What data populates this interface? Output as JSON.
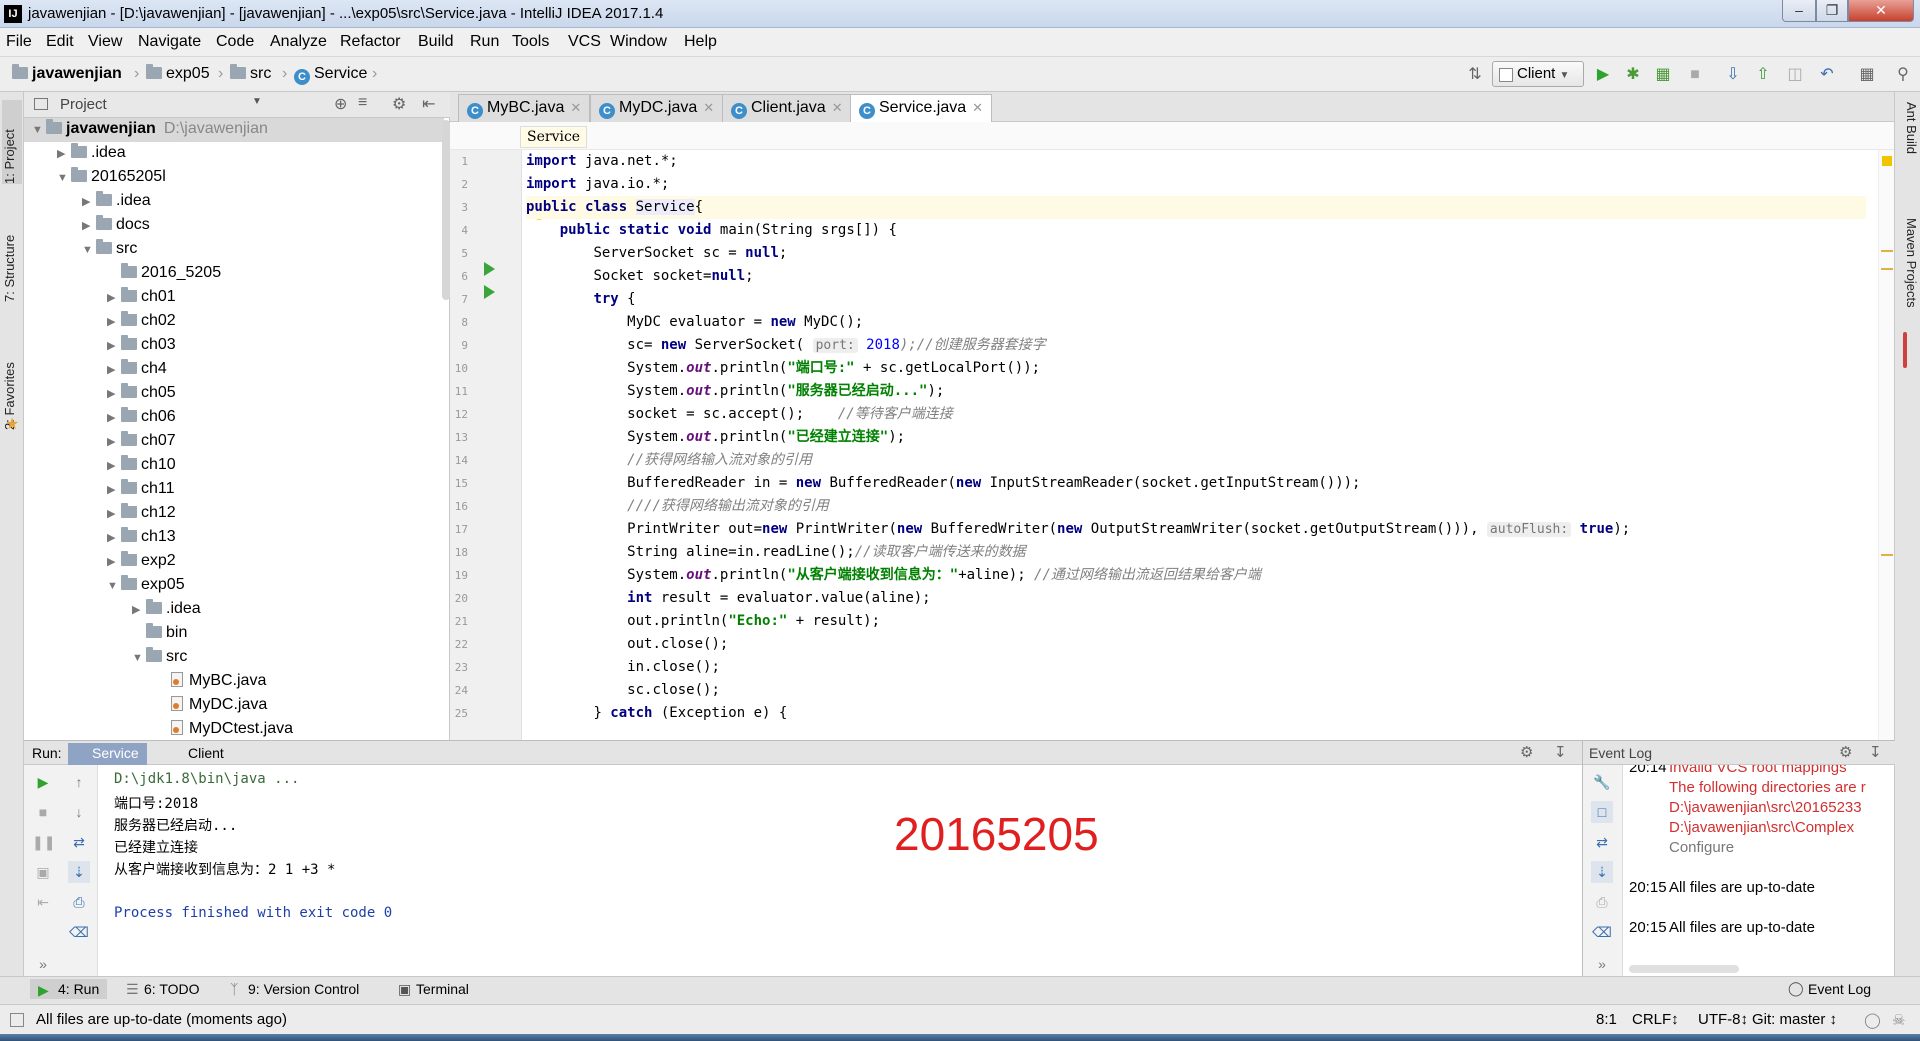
{
  "window": {
    "title": "javawenjian - [D:\\javawenjian] - [javawenjian] - ...\\exp05\\src\\Service.java - IntelliJ IDEA 2017.1.4",
    "icon_letter": "IJ"
  },
  "menu": [
    "File",
    "Edit",
    "View",
    "Navigate",
    "Code",
    "Analyze",
    "Refactor",
    "Build",
    "Run",
    "Tools",
    "VCS",
    "Window",
    "Help"
  ],
  "breadcrumb": [
    "javawenjian",
    "exp05",
    "src",
    "Service"
  ],
  "run_config": "Client",
  "project_panel": {
    "title": "Project",
    "tree": [
      {
        "label": "javawenjian",
        "path": "D:\\javawenjian",
        "depth": 0,
        "type": "module",
        "expanded": true
      },
      {
        "label": ".idea",
        "depth": 1,
        "type": "folder",
        "expanded": false
      },
      {
        "label": "20165205l",
        "depth": 1,
        "type": "folder",
        "expanded": true
      },
      {
        "label": ".idea",
        "depth": 2,
        "type": "folder",
        "expanded": false
      },
      {
        "label": "docs",
        "depth": 2,
        "type": "folder",
        "expanded": false
      },
      {
        "label": "src",
        "depth": 2,
        "type": "folder",
        "expanded": true
      },
      {
        "label": "2016_5205",
        "depth": 3,
        "type": "folder",
        "leaf": true
      },
      {
        "label": "ch01",
        "depth": 3,
        "type": "folder",
        "expanded": false
      },
      {
        "label": "ch02",
        "depth": 3,
        "type": "folder",
        "expanded": false
      },
      {
        "label": "ch03",
        "depth": 3,
        "type": "folder",
        "expanded": false
      },
      {
        "label": "ch4",
        "depth": 3,
        "type": "folder",
        "expanded": false
      },
      {
        "label": "ch05",
        "depth": 3,
        "type": "folder",
        "expanded": false
      },
      {
        "label": "ch06",
        "depth": 3,
        "type": "folder",
        "expanded": false
      },
      {
        "label": "ch07",
        "depth": 3,
        "type": "folder",
        "expanded": false
      },
      {
        "label": "ch10",
        "depth": 3,
        "type": "folder",
        "expanded": false
      },
      {
        "label": "ch11",
        "depth": 3,
        "type": "folder",
        "expanded": false
      },
      {
        "label": "ch12",
        "depth": 3,
        "type": "folder",
        "expanded": false
      },
      {
        "label": "ch13",
        "depth": 3,
        "type": "folder",
        "expanded": false
      },
      {
        "label": "exp2",
        "depth": 3,
        "type": "folder",
        "expanded": false
      },
      {
        "label": "exp05",
        "depth": 3,
        "type": "folder",
        "expanded": true
      },
      {
        "label": ".idea",
        "depth": 4,
        "type": "folder",
        "expanded": false
      },
      {
        "label": "bin",
        "depth": 4,
        "type": "folder",
        "leaf": true
      },
      {
        "label": "src",
        "depth": 4,
        "type": "folder",
        "expanded": true
      },
      {
        "label": "MyBC.java",
        "depth": 5,
        "type": "java"
      },
      {
        "label": "MyDC.java",
        "depth": 5,
        "type": "java"
      },
      {
        "label": "MyDCtest.java",
        "depth": 5,
        "type": "java"
      }
    ]
  },
  "editor": {
    "tabs": [
      {
        "label": "MyBC.java",
        "active": false
      },
      {
        "label": "MyDC.java",
        "active": false
      },
      {
        "label": "Client.java",
        "active": false
      },
      {
        "label": "Service.java",
        "active": true
      }
    ],
    "crumb": "Service",
    "lines": [
      "1",
      "2",
      "3",
      "4",
      "5",
      "6",
      "7",
      "8",
      "9",
      "10",
      "11",
      "12",
      "13",
      "14",
      "15",
      "16",
      "17",
      "18",
      "19",
      "20",
      "21",
      "22",
      "23",
      "24",
      "25"
    ],
    "code": {
      "l1": "java.net.*;",
      "l2": "java.io.*;",
      "l3_cls": "Service",
      "l4": "main(String srgs[]) {",
      "l5": "ServerSocket sc = ",
      "l6": "Socket socket=",
      "l8a": "MyDC evaluator = ",
      "l8b": " MyDC();",
      "l9a": "sc= ",
      "l9b": " ServerSocket( ",
      "l9_hint": "port:",
      "l9_num": " 2018",
      "l9_cmt": ");//创建服务器套接字",
      "l10a": "System.",
      "l10b": ".println(",
      "l10_str": "\"端口号:\"",
      "l10c": " + sc.getLocalPort());",
      "l11_str": "\"服务器已经启动...\"",
      "l12a": "socket = sc.accept();    ",
      "l12_cmt": "//等待客户端连接",
      "l13_str": "\"已经建立连接\"",
      "l14_cmt": "//获得网络输入流对象的引用",
      "l15a": "BufferedReader in = ",
      "l15b": " BufferedReader(",
      "l15c": " InputStreamReader(socket.getInputStream()));",
      "l16_cmt": "////获得网络输出流对象的引用",
      "l17a": "PrintWriter out=",
      "l17b": " PrintWriter(",
      "l17c": " BufferedWriter(",
      "l17d": " OutputStreamWriter(socket.getOutputStream())), ",
      "l17_hint": "autoFlush:",
      "l17e": ");",
      "l18a": "String aline=in.readLine();",
      "l18_cmt": "//读取客户端传送来的数据",
      "l19_str": "\"从客户端接收到信息为：\"",
      "l19b": "+aline); ",
      "l19_cmt": "//通过网络输出流返回结果给客户端",
      "l20a": " result = evaluator.value(aline);",
      "l21a": "out.println(",
      "l21_str": "\"Echo:\"",
      "l21b": " + result);",
      "l22": "out.close();",
      "l23": "in.close();",
      "l24": "sc.close();",
      "l25a": "} ",
      "l25b": " (Exception e) {"
    },
    "keywords": {
      "import": "import",
      "public": "public",
      "class": "class",
      "static": "static",
      "void": "void",
      "null": "null",
      "try": "try",
      "new": "new",
      "out": "out",
      "true": "true",
      "int": "int",
      "catch": "catch"
    }
  },
  "run_panel": {
    "label": "Run:",
    "tabs": [
      {
        "label": "Service",
        "active": true
      },
      {
        "label": "Client",
        "active": false
      }
    ],
    "output": [
      "D:\\jdk1.8\\bin\\java ...",
      "端口号:2018",
      "服务器已经启动...",
      "已经建立连接",
      "从客户端接收到信息为：2 1 +3 *",
      "",
      "Process finished with exit code 0"
    ],
    "watermark": "20165205"
  },
  "event_log": {
    "title": "Event Log",
    "entries": [
      {
        "time": "20:14",
        "text": "Invalid VCS root mappings"
      },
      {
        "time": "",
        "text": "The following directories are r"
      },
      {
        "time": "",
        "text": "D:\\javawenjian\\src\\20165233"
      },
      {
        "time": "",
        "text": "D:\\javawenjian\\src\\Complex"
      },
      {
        "time": "",
        "text": "Configure"
      },
      {
        "time": "20:15",
        "text": "All files are up-to-date"
      },
      {
        "time": "20:15",
        "text": "All files are up-to-date"
      }
    ]
  },
  "left_strip": [
    "1: Project",
    "7: Structure",
    "2: Favorites"
  ],
  "right_strip": [
    "Ant Build",
    "Maven Projects"
  ],
  "bottom_tabs": [
    {
      "label": "4: Run",
      "active": true
    },
    {
      "label": "6: TODO",
      "active": false
    },
    {
      "label": "9: Version Control",
      "active": false
    },
    {
      "label": "Terminal",
      "active": false
    },
    {
      "label": "Event Log",
      "active": false
    }
  ],
  "status": {
    "message": "All files are up-to-date (moments ago)",
    "position": "8:1",
    "line_sep": "CRLF↕",
    "encoding": "UTF-8↕",
    "git": "Git: master ↕"
  },
  "colors": {
    "keyword": "#000080",
    "string": "#008000",
    "comment": "#808080",
    "watermark": "#e02020",
    "event_error": "#d32f2f",
    "run_green": "#3aa53a"
  }
}
